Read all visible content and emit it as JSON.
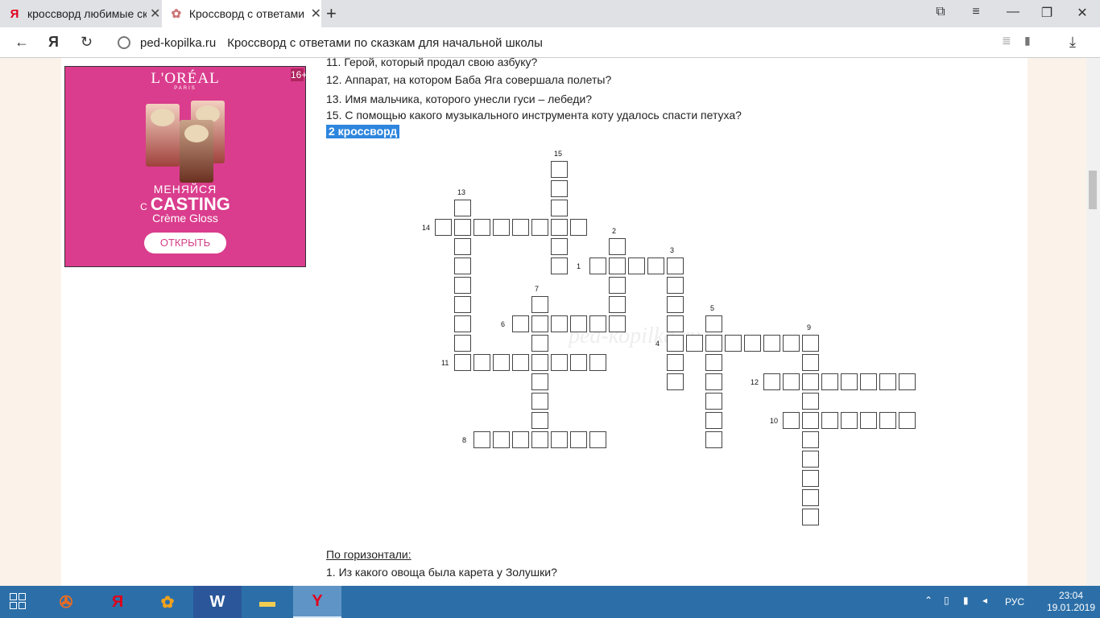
{
  "browser": {
    "tabs": [
      {
        "title": "кроссворд любимые сказки"
      },
      {
        "title": "Кроссворд с ответами по сказкам"
      }
    ],
    "url_host": "ped-kopilka.ru",
    "url_title": "Кроссворд с ответами по сказкам для начальной школы"
  },
  "ad": {
    "brand": "L'ORÉAL",
    "paris": "PARIS",
    "tag1": "МЕНЯЙСЯ",
    "tag_prefix": "С",
    "tag2": "CASTING",
    "tag3": "Crème Gloss",
    "button": "ОТКРЫТЬ",
    "close": "16+"
  },
  "questions": [
    "11. Герой, который продал свою азбуку?",
    "12. Аппарат, на котором Баба Яга совершала полеты?",
    "13. Имя мальчика, которого унесли гуси – лебеди?",
    "15. С помощью какого музыкального инструмента коту удалось спасти петуха?"
  ],
  "selected_link": "2 кроссворд",
  "numbers": [
    "15",
    "13",
    "14",
    "2",
    "3",
    "1",
    "7",
    "5",
    "9",
    "6",
    "4",
    "11",
    "12",
    "10",
    "8"
  ],
  "watermark": "ped-kopilka.ru",
  "horizontal_heading": "По горизонтали:",
  "horizontal_q1": "1. Из какого овоща была карета у Золушки?",
  "taskbar": {
    "lang": "РУС",
    "time": "23:04",
    "date": "19.01.2019"
  }
}
